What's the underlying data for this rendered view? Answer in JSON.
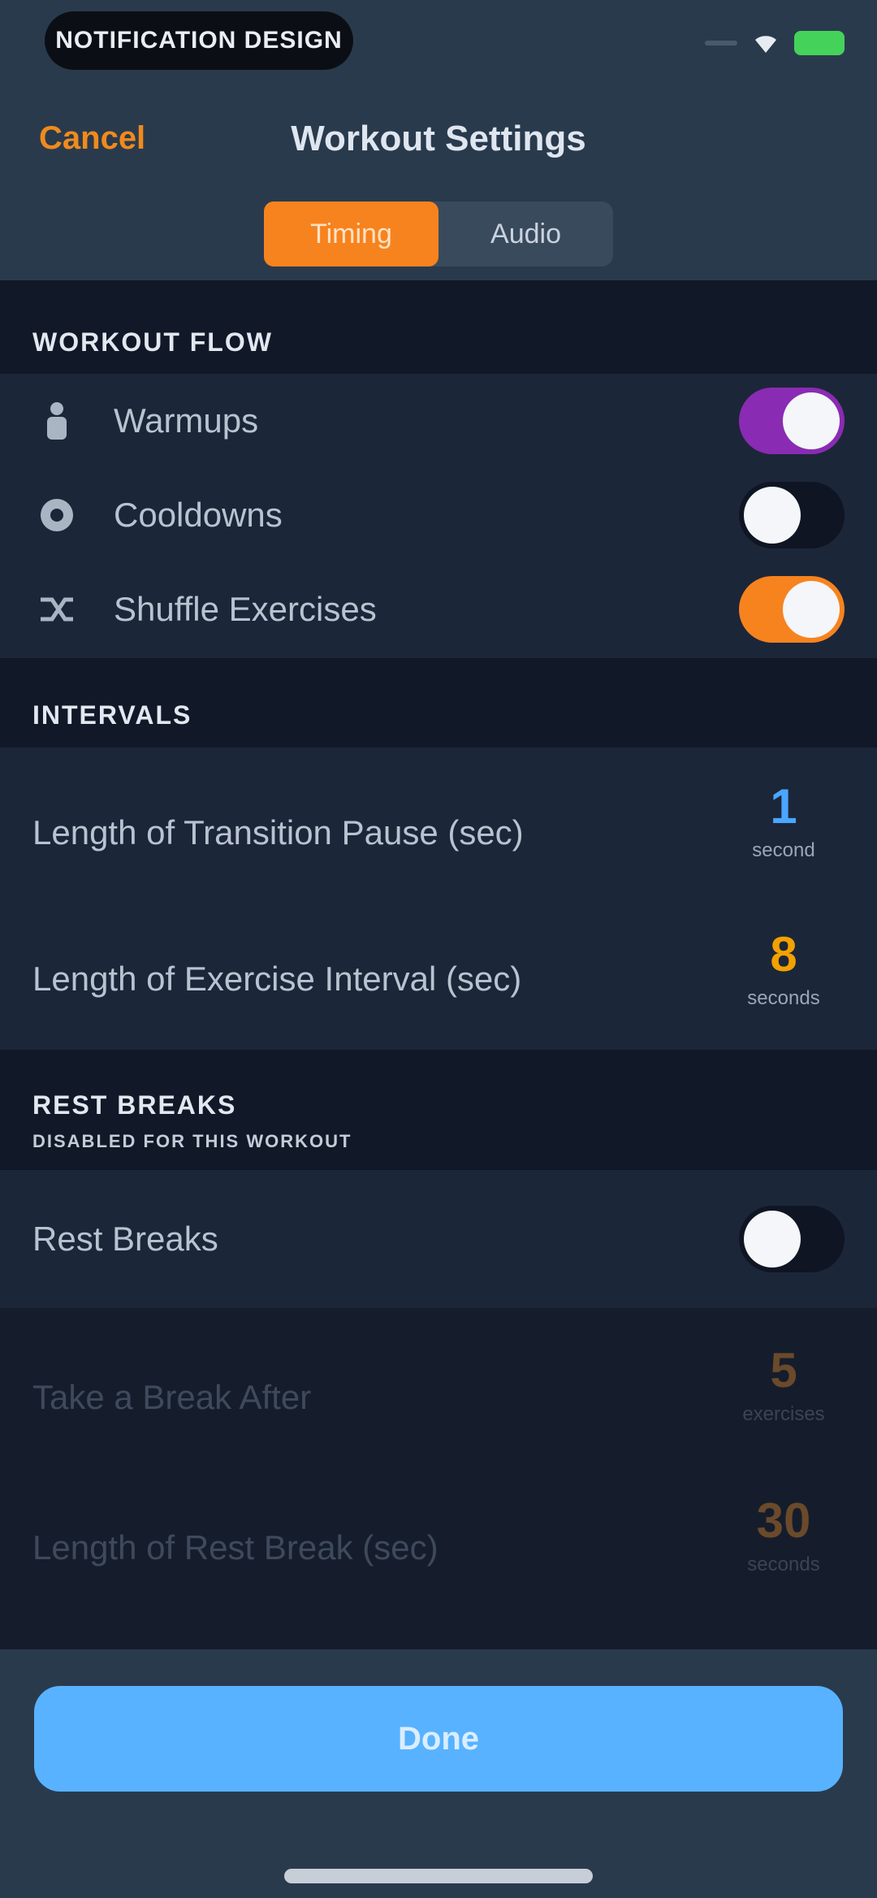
{
  "status_bar": {
    "pill_text": "NOTIFICATION DESIGN"
  },
  "header": {
    "cancel_label": "Cancel",
    "title": "Workout Settings",
    "tabs": [
      {
        "label": "Timing",
        "active": true
      },
      {
        "label": "Audio",
        "active": false
      }
    ]
  },
  "workout_flow": {
    "title": "WORKOUT FLOW",
    "items": [
      {
        "label": "Warmups",
        "icon": "person-icon",
        "on": true,
        "color": "#8a2bb3"
      },
      {
        "label": "Cooldowns",
        "icon": "snowflake-icon",
        "on": false,
        "color": ""
      },
      {
        "label": "Shuffle Exercises",
        "icon": "shuffle-icon",
        "on": true,
        "color": "#f7831e"
      }
    ]
  },
  "intervals": {
    "title": "INTERVALS",
    "items": [
      {
        "label": "Length of Transition Pause (sec)",
        "value": "1",
        "unit": "second",
        "color": "#4aa6ff"
      },
      {
        "label": "Length of Exercise Interval (sec)",
        "value": "8",
        "unit": "seconds",
        "color": "#f2a100"
      }
    ]
  },
  "rest_breaks": {
    "title": "REST BREAKS",
    "subtitle": "DISABLED FOR THIS WORKOUT",
    "toggle_label": "Rest Breaks",
    "toggle_on": false,
    "items": [
      {
        "label": "Take a Break After",
        "value": "5",
        "unit": "exercises"
      },
      {
        "label": "Length of Rest Break (sec)",
        "value": "30",
        "unit": "seconds"
      }
    ]
  },
  "footer": {
    "done_label": "Done"
  },
  "colors": {
    "accent": "#f7831e",
    "primary_button": "#58b2ff",
    "background": "#1c2639"
  }
}
